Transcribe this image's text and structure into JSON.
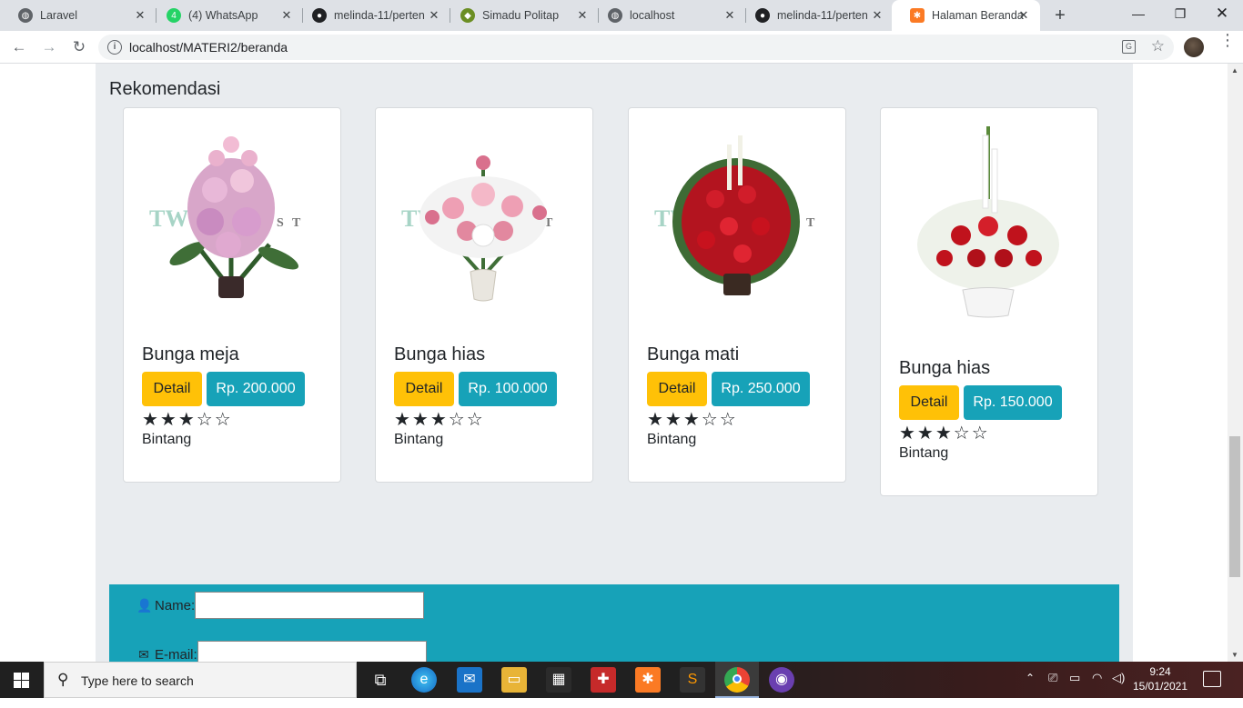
{
  "browser": {
    "tabs": [
      {
        "title": "Laravel",
        "icon": "globe-icon",
        "color": "#5f6368"
      },
      {
        "title": "(4) WhatsApp",
        "icon": "whatsapp-icon",
        "color": "#25d366"
      },
      {
        "title": "melinda-11/perten",
        "icon": "github-icon",
        "color": "#202124"
      },
      {
        "title": "Simadu Politap",
        "icon": "politap-icon",
        "color": "#6b8e23"
      },
      {
        "title": "localhost",
        "icon": "globe-icon",
        "color": "#5f6368"
      },
      {
        "title": "melinda-11/perten",
        "icon": "github-icon",
        "color": "#202124"
      },
      {
        "title": "Halaman Beranda",
        "icon": "xampp-icon",
        "color": "#fb7a24"
      }
    ],
    "url": "localhost/MATERI2/beranda"
  },
  "page": {
    "section_title": "Rekomendasi",
    "products": [
      {
        "name": "Bunga meja",
        "detail_label": "Detail",
        "price": "Rp. 200.000",
        "rating": 3,
        "max_rating": 5,
        "rating_label": "Bintang",
        "theme": "pink"
      },
      {
        "name": "Bunga hias",
        "detail_label": "Detail",
        "price": "Rp. 100.000",
        "rating": 3,
        "max_rating": 5,
        "rating_label": "Bintang",
        "theme": "pinkwhite"
      },
      {
        "name": "Bunga mati",
        "detail_label": "Detail",
        "price": "Rp. 250.000",
        "rating": 3,
        "max_rating": 5,
        "rating_label": "Bintang",
        "theme": "red"
      },
      {
        "name": "Bunga hias",
        "detail_label": "Detail",
        "price": "Rp. 150.000",
        "rating": 3,
        "max_rating": 5,
        "rating_label": "Bintang",
        "theme": "redwhite"
      }
    ],
    "form": {
      "name_label": "Name:",
      "email_label": "E-mail:",
      "name_value": "",
      "email_value": ""
    }
  },
  "taskbar": {
    "search_placeholder": "Type here to search",
    "time": "9:24",
    "date": "15/01/2021"
  },
  "colors": {
    "warning": "#ffc107",
    "info": "#17a2b8"
  }
}
